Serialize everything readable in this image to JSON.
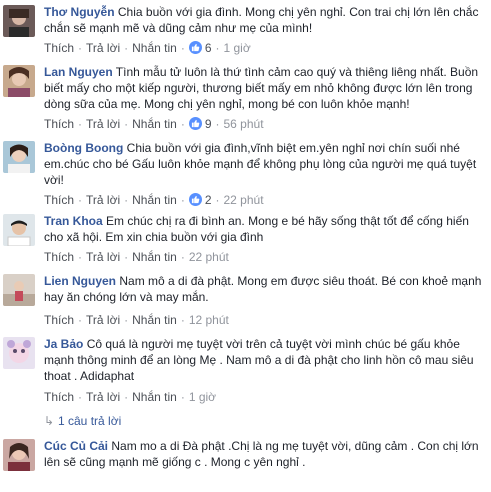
{
  "actions": {
    "like": "Thích",
    "reply": "Trả lời",
    "message": "Nhắn tin"
  },
  "comments": [
    {
      "author": "Thơ Nguyễn",
      "text": "Chia buồn với gia đình. Mong chị yên nghỉ. Con trai chị lớn lên chắc chắn sẽ mạnh mẽ và dũng cảm như mẹ của mình!",
      "likes": "6",
      "time": "1 giờ"
    },
    {
      "author": "Lan Nguyen",
      "text": "Tình mẫu tử luôn là thứ tình cảm cao quý và thiêng liêng nhất. Buồn biết mấy cho một kiếp người, thương biết mấy em nhỏ không được lớn lên trong dòng sữa của mẹ. Mong chị yên nghỉ, mong bé con luôn khỏe mạnh!",
      "likes": "9",
      "time": "56 phút"
    },
    {
      "author": "Boòng Boong",
      "text": "Chia buồn với gia đình,vĩnh biệt em.yên nghỉ nơi chín suối nhé em.chúc cho bé Gấu luôn khỏe mạnh để không phụ lòng của người mẹ quá tuyệt vời!",
      "likes": "2",
      "time": "22 phút"
    },
    {
      "author": "Tran Khoa",
      "text": "Em chúc chị ra đi bình an. Mong e bé hãy sống thật tốt để cống hiến cho xã hội. Em xin chia buồn với gia đình",
      "likes": "",
      "time": "22 phút"
    },
    {
      "author": "Lien Nguyen",
      "text": "Nam mô a di đà phật. Mong em được siêu thoát. Bé con khoẻ mạnh hay ăn chóng lớn và may mắn.",
      "likes": "",
      "time": "12 phút"
    },
    {
      "author": "Ja Bảo",
      "text": "Cô quá là người mẹ tuyệt vời trên cả tuyệt vời mình chúc bé gấu khỏe mạnh thông minh để an lòng Mẹ . Nam mô a di đà phật cho linh hồn cô mau siêu thoat . Adidaphat",
      "likes": "",
      "time": "1 giờ"
    },
    {
      "author": "Cúc Củ Cải",
      "text": "Nam mo a di Đà phật .Chị là ng mẹ tuyệt vời, dũng cảm . Con chị lớn lên sẽ cũng mạnh mẽ giống c . Mong c yên nghỉ .",
      "likes": "",
      "time": ""
    }
  ],
  "replies_link": "1 câu trả lời",
  "colors": {
    "author": "#365899",
    "meta": "#90949c",
    "like": "#5890ff"
  }
}
